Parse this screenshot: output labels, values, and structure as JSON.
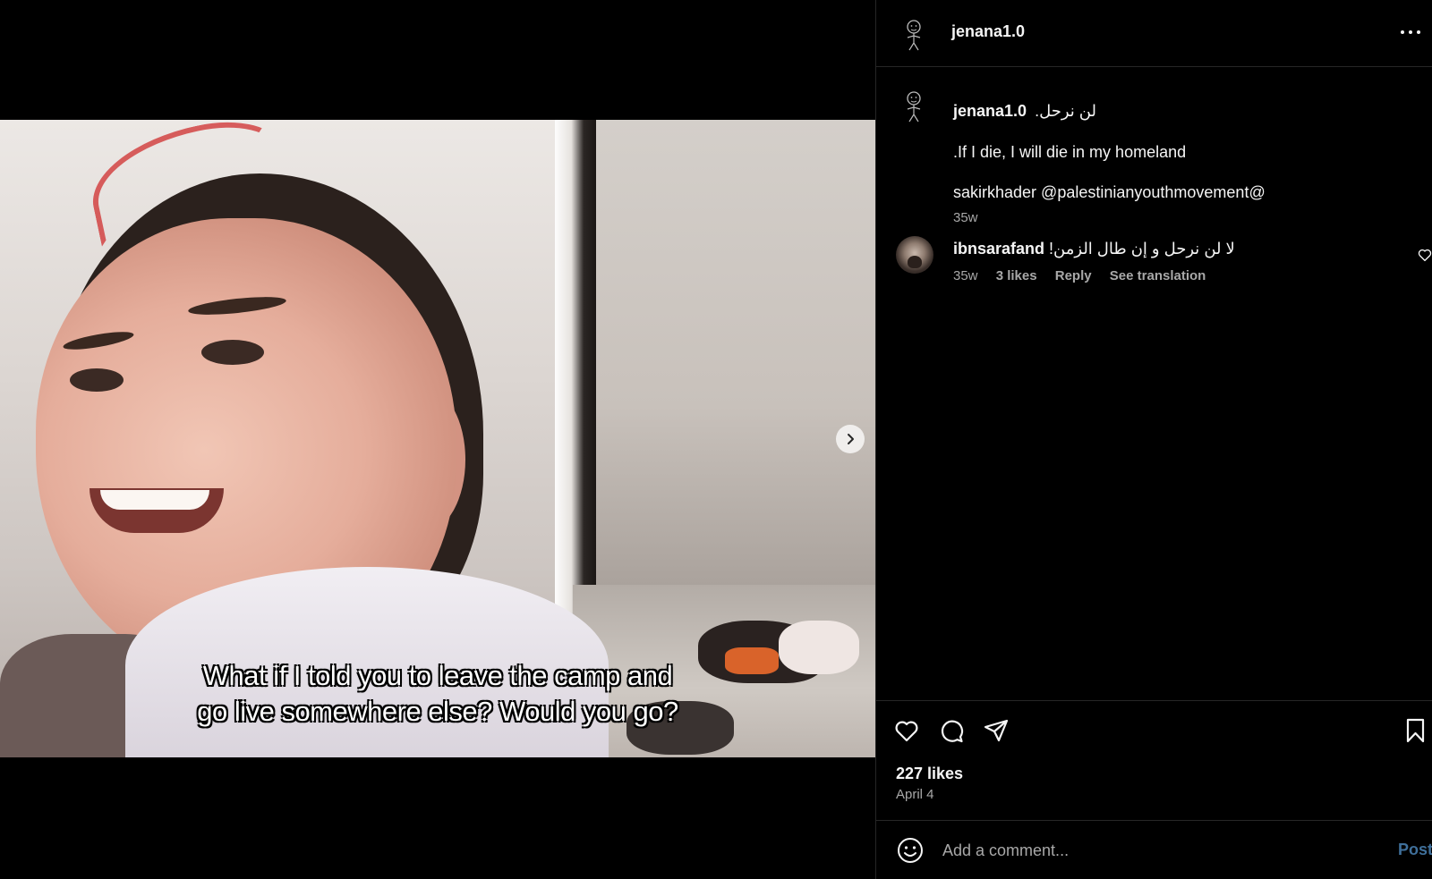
{
  "media": {
    "subtitle_line1": "What if I told you to leave the camp and",
    "subtitle_line2": "go live somewhere else? Would you go?",
    "next_icon": "chevron-right-icon"
  },
  "post": {
    "author": "jenana1.0",
    "more_icon": "more-horizontal-icon",
    "caption": {
      "username": "jenana1.0",
      "line1_text": "لن نرحل.",
      "line2": ".If I die, I will die in my homeland",
      "line3": "sakirkhader @palestinianyouthmovement@",
      "time": "35w"
    },
    "comments": [
      {
        "username": "ibnsarafand",
        "text": "لا لن نرحل و إن طال الزمن!",
        "time": "35w",
        "likes": "3 likes",
        "reply": "Reply",
        "translate": "See translation"
      }
    ],
    "likes": "227 likes",
    "date": "April 4"
  },
  "composer": {
    "placeholder": "Add a comment...",
    "post_label": "Post"
  },
  "colors": {
    "background": "#000000",
    "text": "#f5f5f5",
    "muted": "#a8a8a8",
    "post_button": "#3f6f9a",
    "divider": "#262626"
  }
}
